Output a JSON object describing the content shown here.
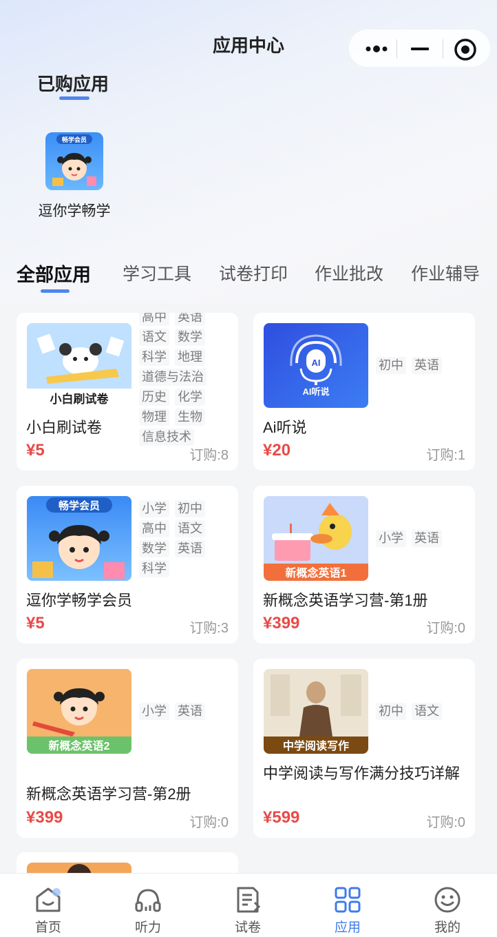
{
  "header": {
    "title": "应用中心"
  },
  "purchased": {
    "title": "已购应用",
    "apps": [
      {
        "name": "逗你学畅学",
        "badge": "畅学会员"
      }
    ]
  },
  "tabs": [
    "全部应用",
    "学习工具",
    "试卷打印",
    "作业批改",
    "作业辅导"
  ],
  "apps": [
    {
      "title": "小白刷试卷",
      "price": "¥5",
      "subs": "订购:8",
      "thumb_label": "小白刷试卷",
      "tags": [
        "高中",
        "英语",
        "语文",
        "数学",
        "科学",
        "地理",
        "道德与法治",
        "历史",
        "化学",
        "物理",
        "生物",
        "信息技术"
      ]
    },
    {
      "title": "Ai听说",
      "price": "¥20",
      "subs": "订购:1",
      "thumb_label": "AI听说",
      "tags": [
        "初中",
        "英语"
      ]
    },
    {
      "title": "逗你学畅学会员",
      "price": "¥5",
      "subs": "订购:3",
      "thumb_label": "畅学会员",
      "tags": [
        "小学",
        "初中",
        "高中",
        "语文",
        "数学",
        "英语",
        "科学"
      ]
    },
    {
      "title": "新概念英语学习营-第1册",
      "price": "¥399",
      "subs": "订购:0",
      "thumb_label": "新概念英语1",
      "tags": [
        "小学",
        "英语"
      ]
    },
    {
      "title": "新概念英语学习营-第2册",
      "price": "¥399",
      "subs": "订购:0",
      "thumb_label": "新概念英语2",
      "tags": [
        "小学",
        "英语"
      ]
    },
    {
      "title": "中学阅读与写作满分技巧详解",
      "price": "¥599",
      "subs": "订购:0",
      "thumb_label": "中学阅读写作",
      "tags": [
        "初中",
        "语文"
      ]
    }
  ],
  "tabbar": {
    "items": [
      {
        "label": "首页",
        "icon": "home-icon"
      },
      {
        "label": "听力",
        "icon": "headphones-icon"
      },
      {
        "label": "试卷",
        "icon": "document-icon"
      },
      {
        "label": "应用",
        "icon": "apps-grid-icon"
      },
      {
        "label": "我的",
        "icon": "smile-icon"
      }
    ],
    "active_index": 3
  },
  "colors": {
    "accent": "#4f86ec",
    "price": "#e94a47",
    "background": "#f4f5f7"
  }
}
